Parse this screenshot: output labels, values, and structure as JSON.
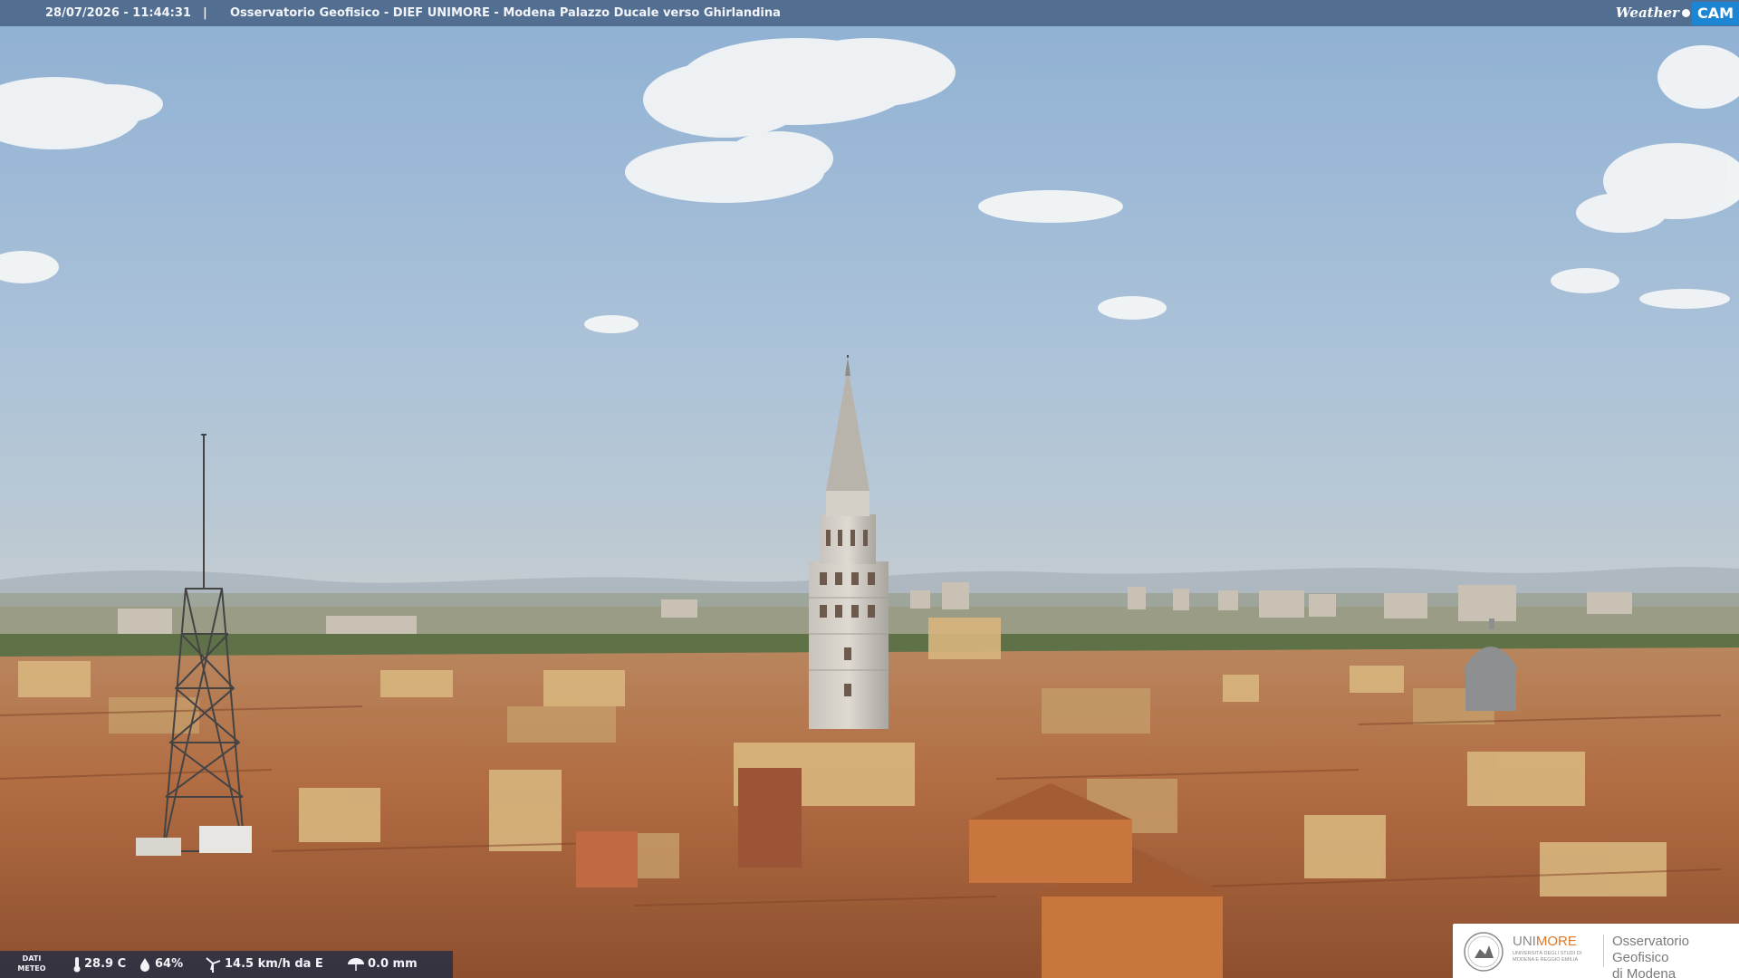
{
  "overlay": {
    "datetime": "28/07/2026 - 11:44:31",
    "separator": "|",
    "camera_title": "Osservatorio Geofisico - DIEF UNIMORE - Modena Palazzo Ducale verso Ghirlandina",
    "brand_weather": "Weather",
    "brand_cam": "CAM"
  },
  "meteo": {
    "label_line1": "DATI",
    "label_line2": "METEO",
    "temperature": "28.9 C",
    "humidity": "64%",
    "wind": "14.5 km/h da E",
    "rain": "0.0 mm"
  },
  "unimore": {
    "name_prefix": "UNI",
    "name_suffix": "MORE",
    "subtitle": "UNIVERSITÀ DEGLI STUDI DI MODENA E REGGIO EMILIA",
    "observatory_line1": "Osservatorio Geofisico",
    "observatory_line2": "di Modena"
  },
  "colors": {
    "accent_orange": "#d8792b",
    "overlay_bar": "#3a5678",
    "brand_blue": "#1c86d4"
  }
}
